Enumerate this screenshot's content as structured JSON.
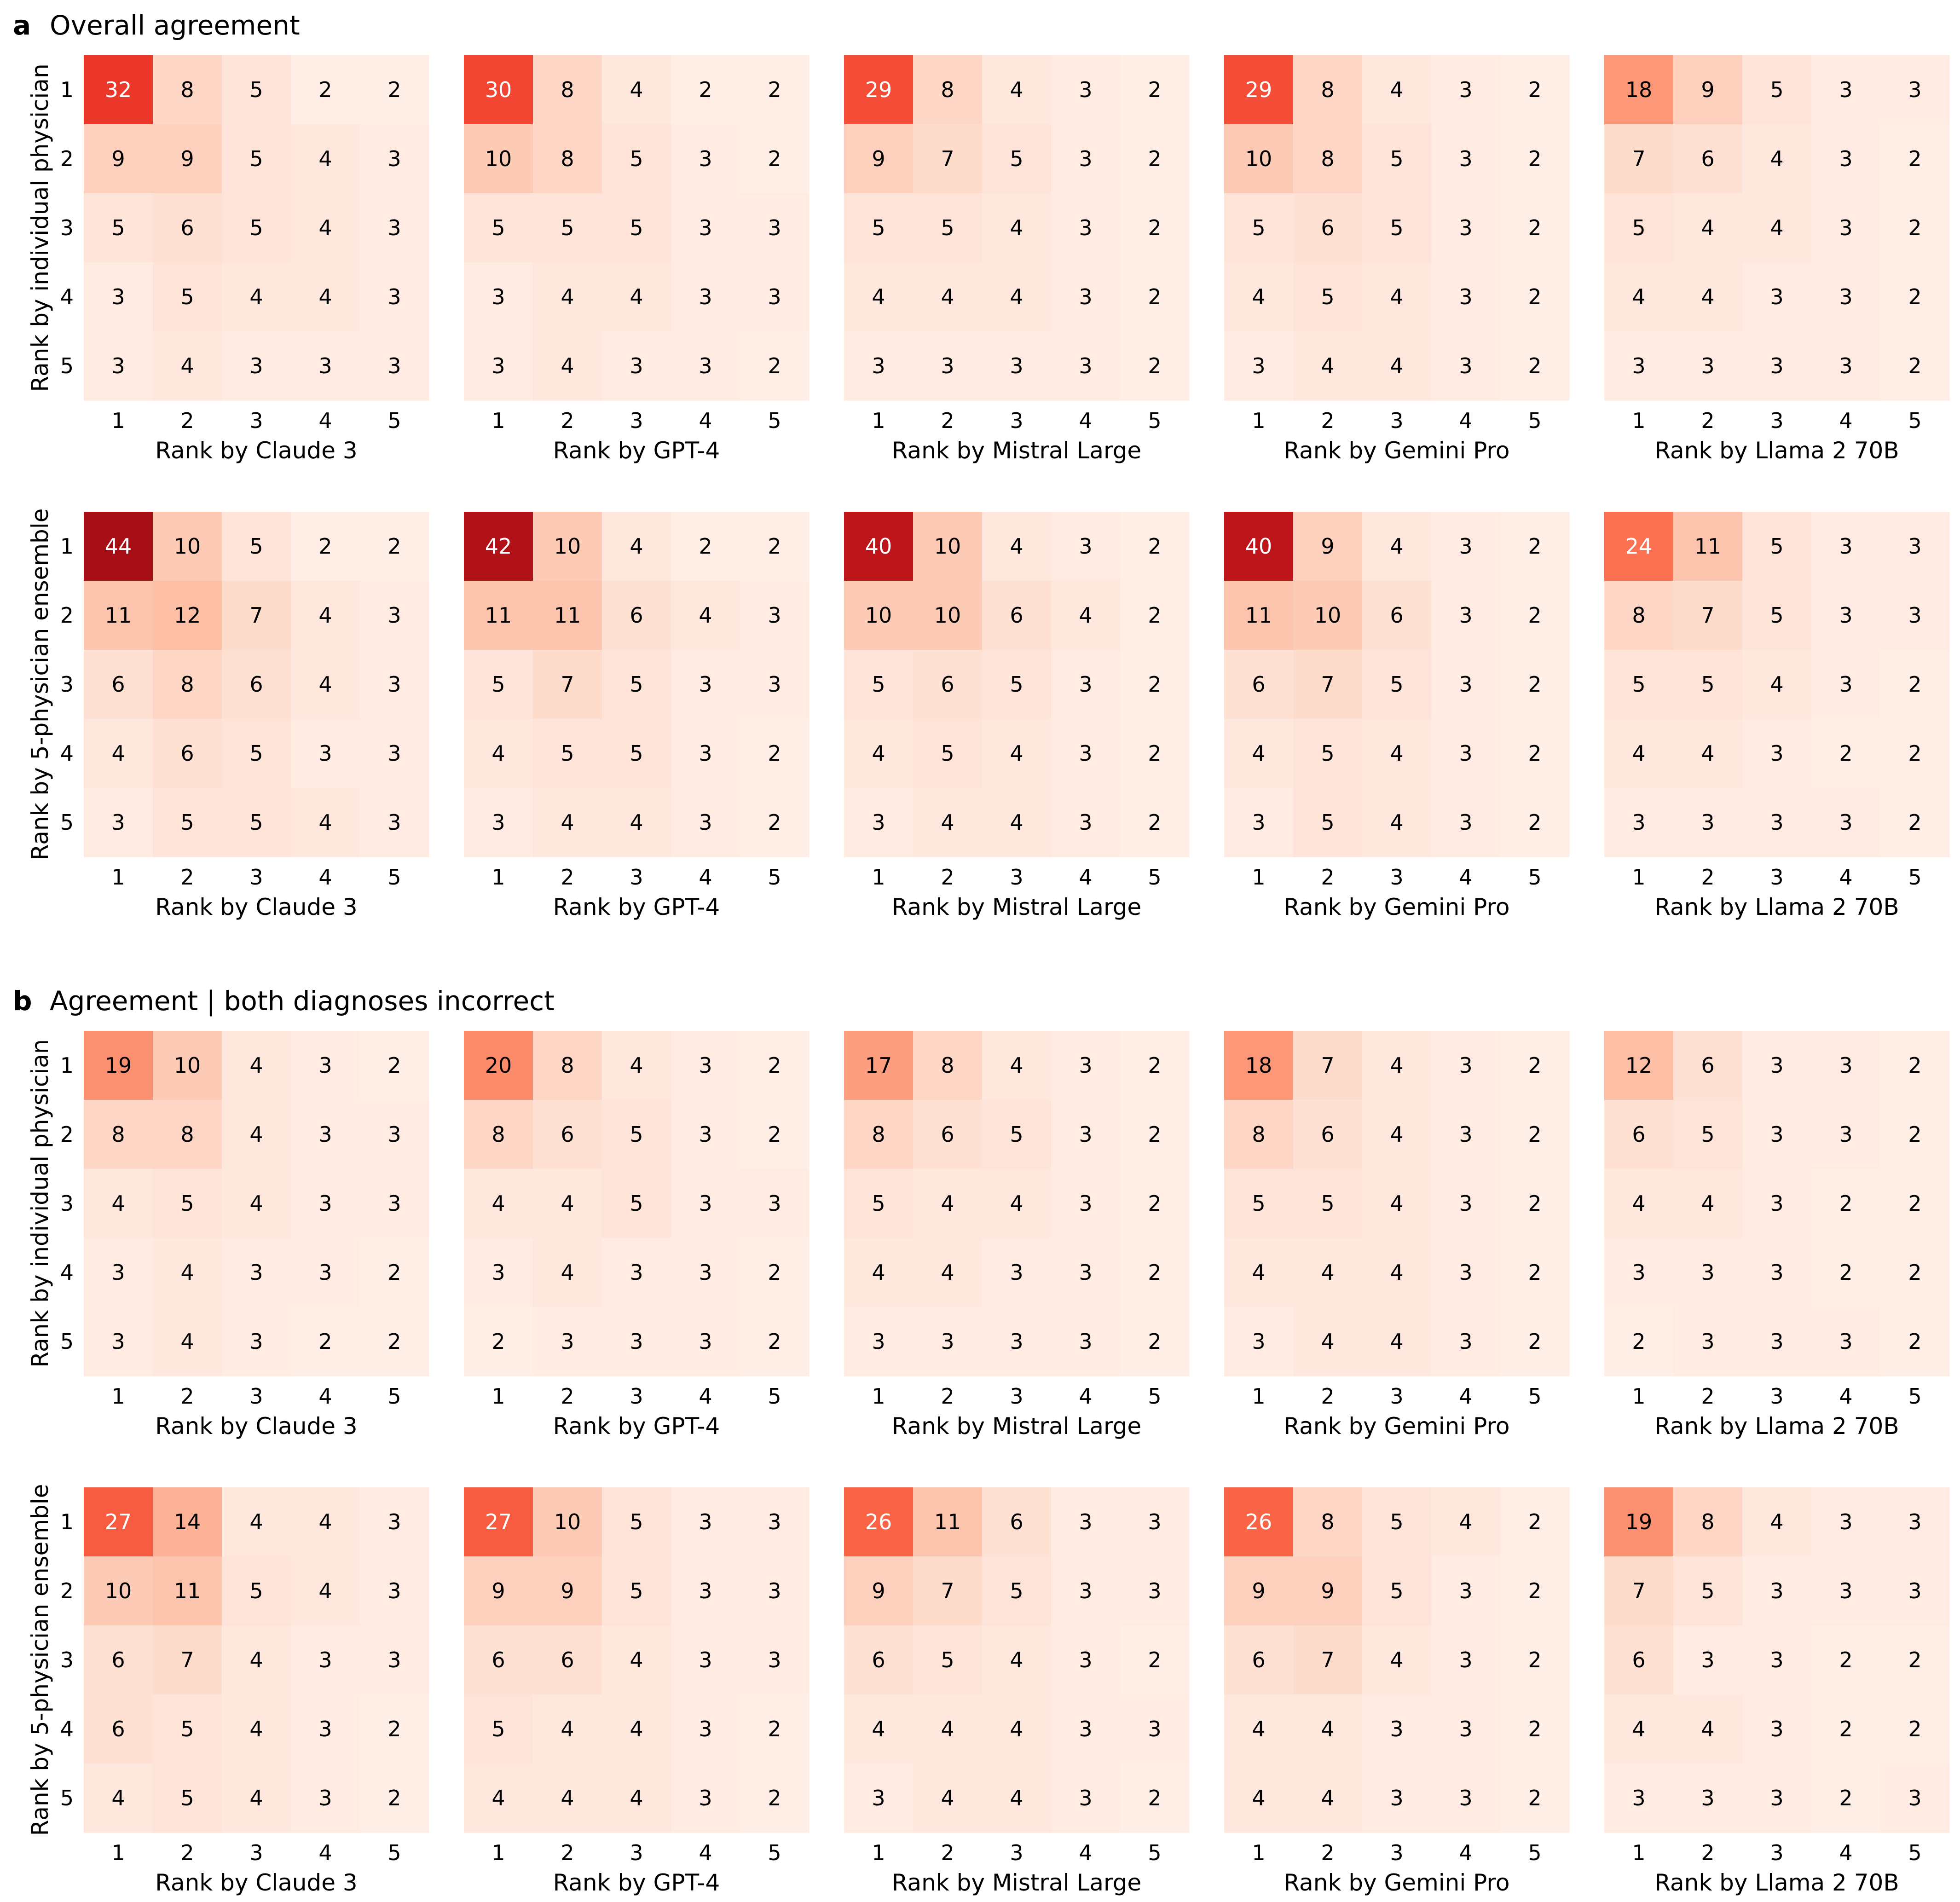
{
  "panels": [
    {
      "letter": "a",
      "title": "Overall agreement"
    },
    {
      "letter": "b",
      "title": "Agreement | both diagnoses incorrect"
    }
  ],
  "row_labels": [
    "Rank by individual physician",
    "Rank by 5-physician ensemble"
  ],
  "col_labels": [
    "Rank by Claude 3",
    "Rank by GPT-4",
    "Rank by Mistral Large",
    "Rank by Gemini Pro",
    "Rank by Llama 2 70B"
  ],
  "tick_labels": [
    "1",
    "2",
    "3",
    "4",
    "5"
  ],
  "colors": {
    "colormap": "Reds",
    "low": "#fff5f0",
    "high": "#a50f15",
    "text_light": "#ffffff",
    "text_dark": "#000000"
  },
  "chart_data": {
    "type": "heatmap",
    "vmin": 0,
    "vmax": 44,
    "grid": false,
    "panels": [
      {
        "panel": "a",
        "rows": [
          {
            "ylabel": "Rank by individual physician",
            "matrices": [
              {
                "xlabel": "Rank by Claude 3",
                "values": [
                  [
                    32,
                    8,
                    5,
                    2,
                    2
                  ],
                  [
                    9,
                    9,
                    5,
                    4,
                    3
                  ],
                  [
                    5,
                    6,
                    5,
                    4,
                    3
                  ],
                  [
                    3,
                    5,
                    4,
                    4,
                    3
                  ],
                  [
                    3,
                    4,
                    3,
                    3,
                    3
                  ]
                ]
              },
              {
                "xlabel": "Rank by GPT-4",
                "values": [
                  [
                    30,
                    8,
                    4,
                    2,
                    2
                  ],
                  [
                    10,
                    8,
                    5,
                    3,
                    2
                  ],
                  [
                    5,
                    5,
                    5,
                    3,
                    3
                  ],
                  [
                    3,
                    4,
                    4,
                    3,
                    3
                  ],
                  [
                    3,
                    4,
                    3,
                    3,
                    2
                  ]
                ]
              },
              {
                "xlabel": "Rank by Mistral Large",
                "values": [
                  [
                    29,
                    8,
                    4,
                    3,
                    2
                  ],
                  [
                    9,
                    7,
                    5,
                    3,
                    2
                  ],
                  [
                    5,
                    5,
                    4,
                    3,
                    2
                  ],
                  [
                    4,
                    4,
                    4,
                    3,
                    2
                  ],
                  [
                    3,
                    3,
                    3,
                    3,
                    2
                  ]
                ]
              },
              {
                "xlabel": "Rank by Gemini Pro",
                "values": [
                  [
                    29,
                    8,
                    4,
                    3,
                    2
                  ],
                  [
                    10,
                    8,
                    5,
                    3,
                    2
                  ],
                  [
                    5,
                    6,
                    5,
                    3,
                    2
                  ],
                  [
                    4,
                    5,
                    4,
                    3,
                    2
                  ],
                  [
                    3,
                    4,
                    4,
                    3,
                    2
                  ]
                ]
              },
              {
                "xlabel": "Rank by Llama 2 70B",
                "values": [
                  [
                    18,
                    9,
                    5,
                    3,
                    3
                  ],
                  [
                    7,
                    6,
                    4,
                    3,
                    2
                  ],
                  [
                    5,
                    4,
                    4,
                    3,
                    2
                  ],
                  [
                    4,
                    4,
                    3,
                    3,
                    2
                  ],
                  [
                    3,
                    3,
                    3,
                    3,
                    2
                  ]
                ]
              }
            ]
          },
          {
            "ylabel": "Rank by 5-physician ensemble",
            "matrices": [
              {
                "xlabel": "Rank by Claude 3",
                "values": [
                  [
                    44,
                    10,
                    5,
                    2,
                    2
                  ],
                  [
                    11,
                    12,
                    7,
                    4,
                    3
                  ],
                  [
                    6,
                    8,
                    6,
                    4,
                    3
                  ],
                  [
                    4,
                    6,
                    5,
                    3,
                    3
                  ],
                  [
                    3,
                    5,
                    5,
                    4,
                    3
                  ]
                ]
              },
              {
                "xlabel": "Rank by GPT-4",
                "values": [
                  [
                    42,
                    10,
                    4,
                    2,
                    2
                  ],
                  [
                    11,
                    11,
                    6,
                    4,
                    3
                  ],
                  [
                    5,
                    7,
                    5,
                    3,
                    3
                  ],
                  [
                    4,
                    5,
                    5,
                    3,
                    2
                  ],
                  [
                    3,
                    4,
                    4,
                    3,
                    2
                  ]
                ]
              },
              {
                "xlabel": "Rank by Mistral Large",
                "values": [
                  [
                    40,
                    10,
                    4,
                    3,
                    2
                  ],
                  [
                    10,
                    10,
                    6,
                    4,
                    2
                  ],
                  [
                    5,
                    6,
                    5,
                    3,
                    2
                  ],
                  [
                    4,
                    5,
                    4,
                    3,
                    2
                  ],
                  [
                    3,
                    4,
                    4,
                    3,
                    2
                  ]
                ]
              },
              {
                "xlabel": "Rank by Gemini Pro",
                "values": [
                  [
                    40,
                    9,
                    4,
                    3,
                    2
                  ],
                  [
                    11,
                    10,
                    6,
                    3,
                    2
                  ],
                  [
                    6,
                    7,
                    5,
                    3,
                    2
                  ],
                  [
                    4,
                    5,
                    4,
                    3,
                    2
                  ],
                  [
                    3,
                    5,
                    4,
                    3,
                    2
                  ]
                ]
              },
              {
                "xlabel": "Rank by Llama 2 70B",
                "values": [
                  [
                    24,
                    11,
                    5,
                    3,
                    3
                  ],
                  [
                    8,
                    7,
                    5,
                    3,
                    3
                  ],
                  [
                    5,
                    5,
                    4,
                    3,
                    2
                  ],
                  [
                    4,
                    4,
                    3,
                    2,
                    2
                  ],
                  [
                    3,
                    3,
                    3,
                    3,
                    2
                  ]
                ]
              }
            ]
          }
        ]
      },
      {
        "panel": "b",
        "rows": [
          {
            "ylabel": "Rank by individual physician",
            "matrices": [
              {
                "xlabel": "Rank by Claude 3",
                "values": [
                  [
                    19,
                    10,
                    4,
                    3,
                    2
                  ],
                  [
                    8,
                    8,
                    4,
                    3,
                    3
                  ],
                  [
                    4,
                    5,
                    4,
                    3,
                    3
                  ],
                  [
                    3,
                    4,
                    3,
                    3,
                    2
                  ],
                  [
                    3,
                    4,
                    3,
                    2,
                    2
                  ]
                ]
              },
              {
                "xlabel": "Rank by GPT-4",
                "values": [
                  [
                    20,
                    8,
                    4,
                    3,
                    2
                  ],
                  [
                    8,
                    6,
                    5,
                    3,
                    2
                  ],
                  [
                    4,
                    4,
                    5,
                    3,
                    3
                  ],
                  [
                    3,
                    4,
                    3,
                    3,
                    2
                  ],
                  [
                    2,
                    3,
                    3,
                    3,
                    2
                  ]
                ]
              },
              {
                "xlabel": "Rank by Mistral Large",
                "values": [
                  [
                    17,
                    8,
                    4,
                    3,
                    2
                  ],
                  [
                    8,
                    6,
                    5,
                    3,
                    2
                  ],
                  [
                    5,
                    4,
                    4,
                    3,
                    2
                  ],
                  [
                    4,
                    4,
                    3,
                    3,
                    2
                  ],
                  [
                    3,
                    3,
                    3,
                    3,
                    2
                  ]
                ]
              },
              {
                "xlabel": "Rank by Gemini Pro",
                "values": [
                  [
                    18,
                    7,
                    4,
                    3,
                    2
                  ],
                  [
                    8,
                    6,
                    4,
                    3,
                    2
                  ],
                  [
                    5,
                    5,
                    4,
                    3,
                    2
                  ],
                  [
                    4,
                    4,
                    4,
                    3,
                    2
                  ],
                  [
                    3,
                    4,
                    4,
                    3,
                    2
                  ]
                ]
              },
              {
                "xlabel": "Rank by Llama 2 70B",
                "values": [
                  [
                    12,
                    6,
                    3,
                    3,
                    2
                  ],
                  [
                    6,
                    5,
                    3,
                    3,
                    2
                  ],
                  [
                    4,
                    4,
                    3,
                    2,
                    2
                  ],
                  [
                    3,
                    3,
                    3,
                    2,
                    2
                  ],
                  [
                    2,
                    3,
                    3,
                    3,
                    2
                  ]
                ]
              }
            ]
          },
          {
            "ylabel": "Rank by 5-physician ensemble",
            "matrices": [
              {
                "xlabel": "Rank by Claude 3",
                "values": [
                  [
                    27,
                    14,
                    4,
                    4,
                    3
                  ],
                  [
                    10,
                    11,
                    5,
                    4,
                    3
                  ],
                  [
                    6,
                    7,
                    4,
                    3,
                    3
                  ],
                  [
                    6,
                    5,
                    4,
                    3,
                    2
                  ],
                  [
                    4,
                    5,
                    4,
                    3,
                    2
                  ]
                ]
              },
              {
                "xlabel": "Rank by GPT-4",
                "values": [
                  [
                    27,
                    10,
                    5,
                    3,
                    3
                  ],
                  [
                    9,
                    9,
                    5,
                    3,
                    3
                  ],
                  [
                    6,
                    6,
                    4,
                    3,
                    3
                  ],
                  [
                    5,
                    4,
                    4,
                    3,
                    2
                  ],
                  [
                    4,
                    4,
                    4,
                    3,
                    2
                  ]
                ]
              },
              {
                "xlabel": "Rank by Mistral Large",
                "values": [
                  [
                    26,
                    11,
                    6,
                    3,
                    3
                  ],
                  [
                    9,
                    7,
                    5,
                    3,
                    3
                  ],
                  [
                    6,
                    5,
                    4,
                    3,
                    2
                  ],
                  [
                    4,
                    4,
                    4,
                    3,
                    3
                  ],
                  [
                    3,
                    4,
                    4,
                    3,
                    2
                  ]
                ]
              },
              {
                "xlabel": "Rank by Gemini Pro",
                "values": [
                  [
                    26,
                    8,
                    5,
                    4,
                    2
                  ],
                  [
                    9,
                    9,
                    5,
                    3,
                    2
                  ],
                  [
                    6,
                    7,
                    4,
                    3,
                    2
                  ],
                  [
                    4,
                    4,
                    3,
                    3,
                    2
                  ],
                  [
                    4,
                    4,
                    3,
                    3,
                    2
                  ]
                ]
              },
              {
                "xlabel": "Rank by Llama 2 70B",
                "values": [
                  [
                    19,
                    8,
                    4,
                    3,
                    3
                  ],
                  [
                    7,
                    5,
                    3,
                    3,
                    3
                  ],
                  [
                    6,
                    3,
                    3,
                    2,
                    2
                  ],
                  [
                    4,
                    4,
                    3,
                    2,
                    2
                  ],
                  [
                    3,
                    3,
                    3,
                    2,
                    3
                  ]
                ]
              }
            ]
          }
        ]
      }
    ]
  }
}
